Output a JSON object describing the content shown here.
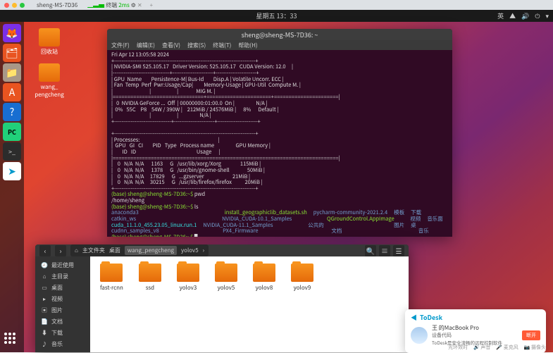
{
  "mac": {
    "tab1": "sheng-MS-7D36",
    "tab2": "终端",
    "ping": "2ms"
  },
  "topbar": {
    "clock": "星期五 13：33",
    "lang": "英"
  },
  "desk_icons": [
    {
      "label": "回收站"
    },
    {
      "label": "wang_\npengcheng"
    }
  ],
  "dock": [
    {
      "name": "firefox",
      "glyph": "🦊"
    },
    {
      "name": "files",
      "glyph": "📁"
    },
    {
      "name": "folder",
      "glyph": "🗂"
    },
    {
      "name": "software",
      "glyph": "A"
    },
    {
      "name": "help",
      "glyph": "?"
    },
    {
      "name": "pycharm",
      "glyph": "PC"
    },
    {
      "name": "terminal",
      "glyph": ">_"
    },
    {
      "name": "todesk",
      "glyph": "➤"
    }
  ],
  "terminal": {
    "title": "sheng@sheng-MS-7D36: ~",
    "menu": [
      "文件(F)",
      "编辑(E)",
      "查看(V)",
      "搜索(S)",
      "终端(T)",
      "帮助(H)"
    ],
    "nvsmi": "Fri Apr 12 13:05:58 2024\n+-----------------------------------------------------------------------------+\n| NVIDIA-SMI 525.105.17   Driver Version: 525.105.17   CUDA Version: 12.0     |\n|-------------------------------+----------------------+----------------------+\n| GPU  Name        Persistence-M| Bus-Id        Disp.A | Volatile Uncorr. ECC |\n| Fan  Temp  Perf  Pwr:Usage/Cap|         Memory-Usage | GPU-Util  Compute M. |\n|                               |                      |               MIG M. |\n|===============================+======================+======================|\n|   0  NVIDIA GeForce ...  Off  | 00000000:01:00.0  On |                  N/A |\n|  0%   55C    P8    54W / 390W |    212MiB / 24576MiB |      8%      Default |\n|                               |                      |                  N/A |\n+-------------------------------+----------------------+----------------------+\n\n+-----------------------------------------------------------------------------+\n| Processes:                                                                  |\n|  GPU   GI   CI        PID   Type   Process name                  GPU Memory |\n|        ID   ID                                                   Usage      |\n|=============================================================================|\n|    0   N/A  N/A      1163      G   /usr/lib/xorg/Xorg                115MiB |\n|    0   N/A  N/A      1378      G   /usr/bin/gnome-shell               50MiB |\n|    0   N/A  N/A     17829      G   ...gzserver                        21MiB |\n|    0   N/A  N/A     30215      G   /usr/lib/firefox/firefox           20MiB |\n+-----------------------------------------------------------------------------+",
    "prompt": "(base) sheng@sheng-MS-7D36:~$ ",
    "cmd1": "pwd",
    "out1": "/home/sheng",
    "cmd2": "ls",
    "ls": {
      "col1": [
        "anaconda3",
        "catkin_ws",
        "cuda_11.1.0_455.23.05_linux.run.1",
        "cudnn_samples_v8"
      ],
      "col2": [
        "install_geographiclib_datasets.sh",
        "NVIDIA_CUDA-10.1_Samples",
        "NVIDIA_CUDA-11.1_Samples",
        "PX4_Firmware"
      ],
      "col3": [
        "pycharm-community-2021.2.4",
        "QGroundControl.AppImage",
        "公共的",
        "文档"
      ],
      "col4": [
        "模板",
        "视频",
        "图片",
        "音乐"
      ],
      "col5": [
        "下载",
        "音乐面",
        "桌"
      ]
    }
  },
  "files": {
    "breadcrumb": [
      "主文件夹",
      "桌面",
      "wang_pengcheng",
      "yolov5"
    ],
    "sidebar": [
      {
        "icon": "🕘",
        "label": "最近使用"
      },
      {
        "icon": "⌂",
        "label": "主目录"
      },
      {
        "icon": "▭",
        "label": "桌面"
      },
      {
        "icon": "▸",
        "label": "视频"
      },
      {
        "icon": "▣",
        "label": "图片"
      },
      {
        "icon": "📄",
        "label": "文档"
      },
      {
        "icon": "⬇",
        "label": "下载"
      },
      {
        "icon": "♪",
        "label": "音乐"
      }
    ],
    "folders": [
      "fast-rcnn",
      "ssd",
      "yolov3",
      "yolov5",
      "yolov8",
      "yolov9"
    ]
  },
  "todesk": {
    "brand": "ToDesk",
    "device": "王    的MacBook Pro",
    "sub": "设备代码",
    "desc": "ToDesk是安全流畅的远程控制软件",
    "btn": "断开"
  },
  "footer": {
    "light": "光环效时",
    "items": [
      "🔊 声音",
      "🎤 麦克风",
      "📷 摄像头"
    ]
  }
}
